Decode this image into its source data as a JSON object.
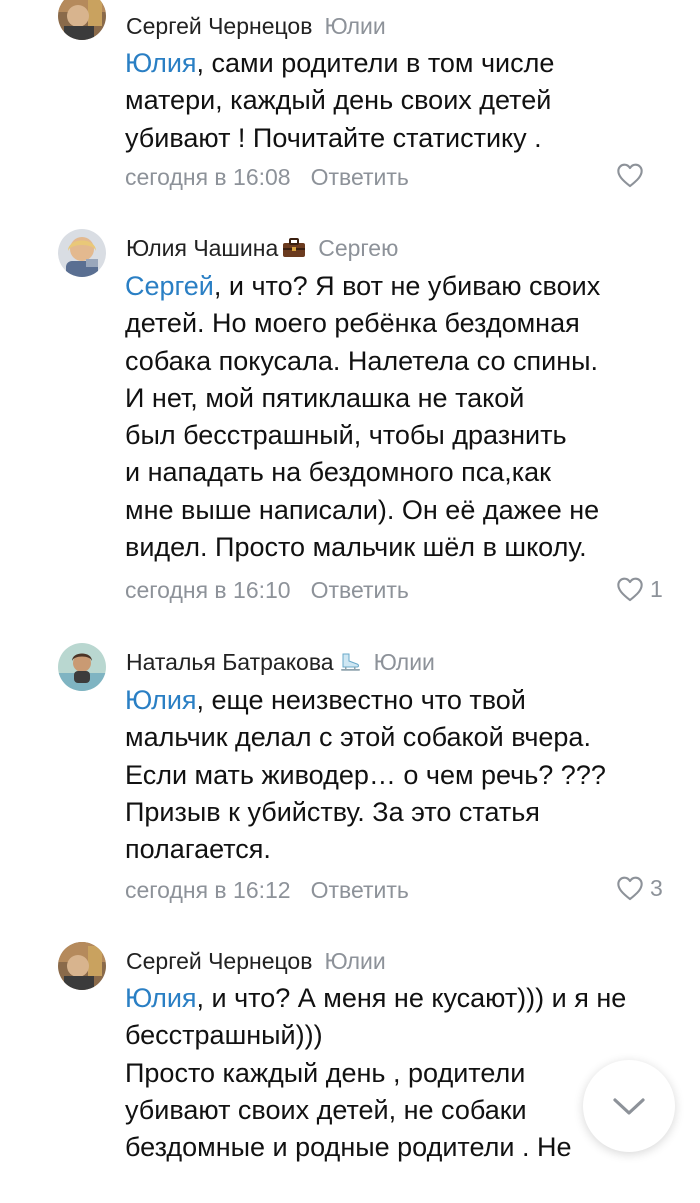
{
  "comments": [
    {
      "author": "Сергей Чернецов",
      "reply_to": "Юлии",
      "mention": "Юлия",
      "lines": [
        ", сами родители в том числе",
        "матери, каждый день своих детей",
        "убивают ! Почитайте статистику ."
      ],
      "time": "сегодня в 16:08",
      "reply_label": "Ответить",
      "likes": ""
    },
    {
      "author": "Юлия Чашина",
      "badge_icon": "briefcase-icon",
      "reply_to": "Сергею",
      "mention": "Сергей",
      "lines": [
        ", и что? Я вот не убиваю своих",
        "детей. Но моего ребёнка бездомная",
        "собака покусала. Налетела со спины.",
        "И нет, мой пятиклашка не такой",
        "был бесстрашный, чтобы дразнить",
        "и нападать на бездомного пса,как",
        "мне выше написали). Он её дажее не",
        "видел. Просто мальчик шёл в школу."
      ],
      "time": "сегодня в 16:10",
      "reply_label": "Ответить",
      "likes": "1"
    },
    {
      "author": "Наталья Батракова",
      "badge_icon": "ice-skate-icon",
      "reply_to": "Юлии",
      "mention": "Юлия",
      "lines": [
        ", еще неизвестно что твой",
        "мальчик делал с этой собакой вчера.",
        "Если мать живодер… о чем речь? ???",
        "Призыв к убийству. За это статья",
        "полагается."
      ],
      "time": "сегодня в 16:12",
      "reply_label": "Ответить",
      "likes": "3"
    },
    {
      "author": "Сергей Чернецов",
      "reply_to": "Юлии",
      "mention": "Юлия",
      "lines": [
        ", и что? А меня не кусают))) и я не",
        "бесстрашный)))",
        "Просто каждый день , родители",
        "убивают своих детей, не собаки",
        "бездомные и родные родители . Не"
      ],
      "time": "",
      "reply_label": "",
      "likes": ""
    }
  ],
  "scroll_button": {
    "icon": "chevron-down-icon"
  },
  "colors": {
    "text": "#111111",
    "author": "#222222",
    "mention": "#2a7fc4",
    "muted": "#8d9299",
    "background": "#ffffff"
  }
}
